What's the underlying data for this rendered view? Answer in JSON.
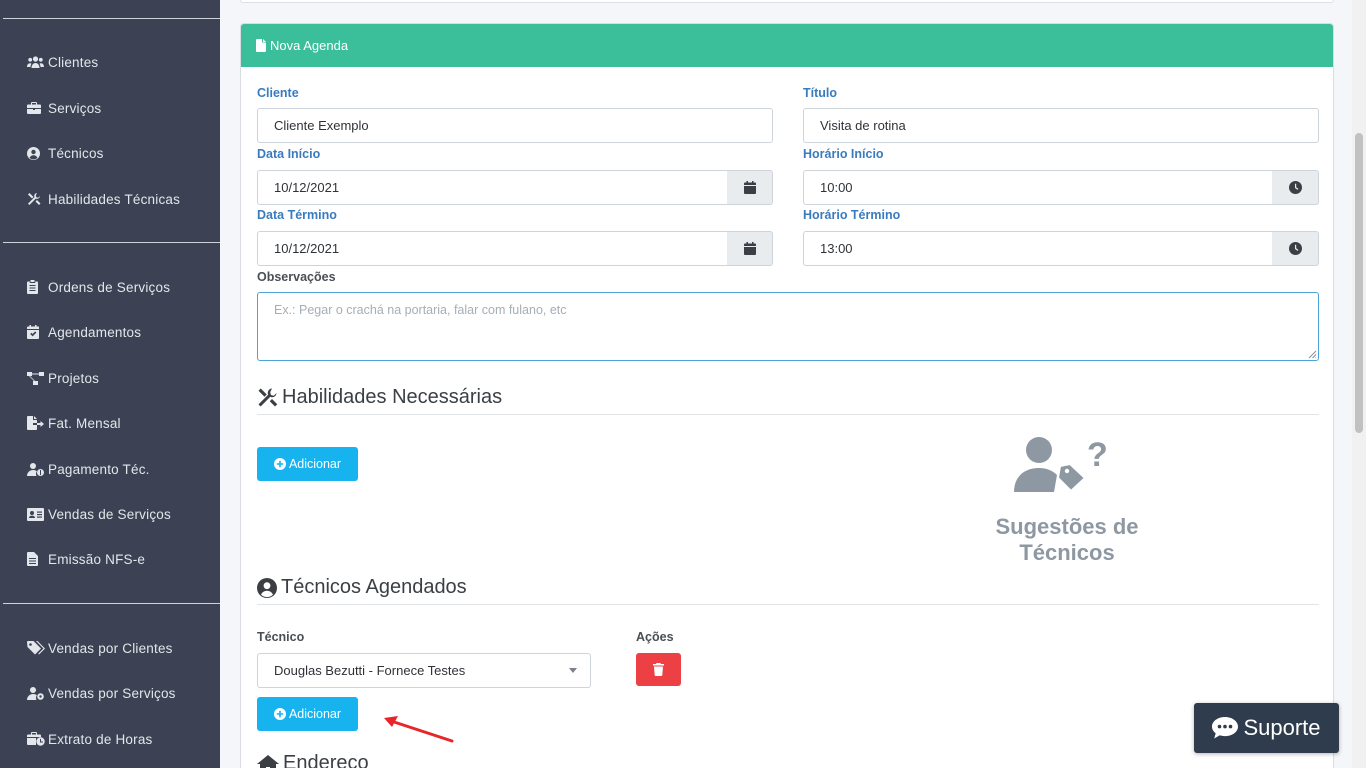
{
  "sidebar": {
    "items": [
      {
        "label": "Clientes",
        "icon": "users-icon"
      },
      {
        "label": "Serviços",
        "icon": "briefcase-icon"
      },
      {
        "label": "Técnicos",
        "icon": "user-circle-icon"
      },
      {
        "label": "Habilidades Técnicas",
        "icon": "tools-icon"
      },
      {
        "label": "Ordens de Serviços",
        "icon": "clipboard-icon"
      },
      {
        "label": "Agendamentos",
        "icon": "calendar-check-icon"
      },
      {
        "label": "Projetos",
        "icon": "project-diagram-icon"
      },
      {
        "label": "Fat. Mensal",
        "icon": "file-export-icon"
      },
      {
        "label": "Pagamento Téc.",
        "icon": "user-dollar-icon"
      },
      {
        "label": "Vendas de Serviços",
        "icon": "id-card-icon"
      },
      {
        "label": "Emissão NFS-e",
        "icon": "file-invoice-icon"
      },
      {
        "label": "Vendas por Clientes",
        "icon": "tags-icon"
      },
      {
        "label": "Vendas por Serviços",
        "icon": "user-cog-icon"
      },
      {
        "label": "Extrato de Horas",
        "icon": "briefcase-clock-icon"
      }
    ]
  },
  "card": {
    "title": "Nova Agenda"
  },
  "form": {
    "cliente_label": "Cliente",
    "cliente_value": "Cliente Exemplo",
    "titulo_label": "Título",
    "titulo_value": "Visita de rotina",
    "data_inicio_label": "Data Início",
    "data_inicio_value": "10/12/2021",
    "horario_inicio_label": "Horário Início",
    "horario_inicio_value": "10:00",
    "data_termino_label": "Data Término",
    "data_termino_value": "10/12/2021",
    "horario_termino_label": "Horário Término",
    "horario_termino_value": "13:00",
    "observacoes_label": "Observações",
    "observacoes_placeholder": "Ex.: Pegar o crachá na portaria, falar com fulano, etc"
  },
  "habilidades": {
    "title": "Habilidades Necessárias",
    "add_label": "Adicionar",
    "suggest_label": "Sugestões de Técnicos"
  },
  "tecnicos": {
    "title": "Técnicos Agendados",
    "col_tecnico": "Técnico",
    "col_acoes": "Ações",
    "selected": "Douglas Bezutti - Fornece Testes",
    "add_label": "Adicionar"
  },
  "endereco": {
    "title": "Endereço"
  },
  "support": {
    "label": "Suporte"
  },
  "colors": {
    "header": "#3abf9a",
    "sidebar": "#3c4253",
    "add_button": "#17b3ee",
    "delete_button": "#ec4044",
    "label_blue": "#3a7bbf"
  }
}
